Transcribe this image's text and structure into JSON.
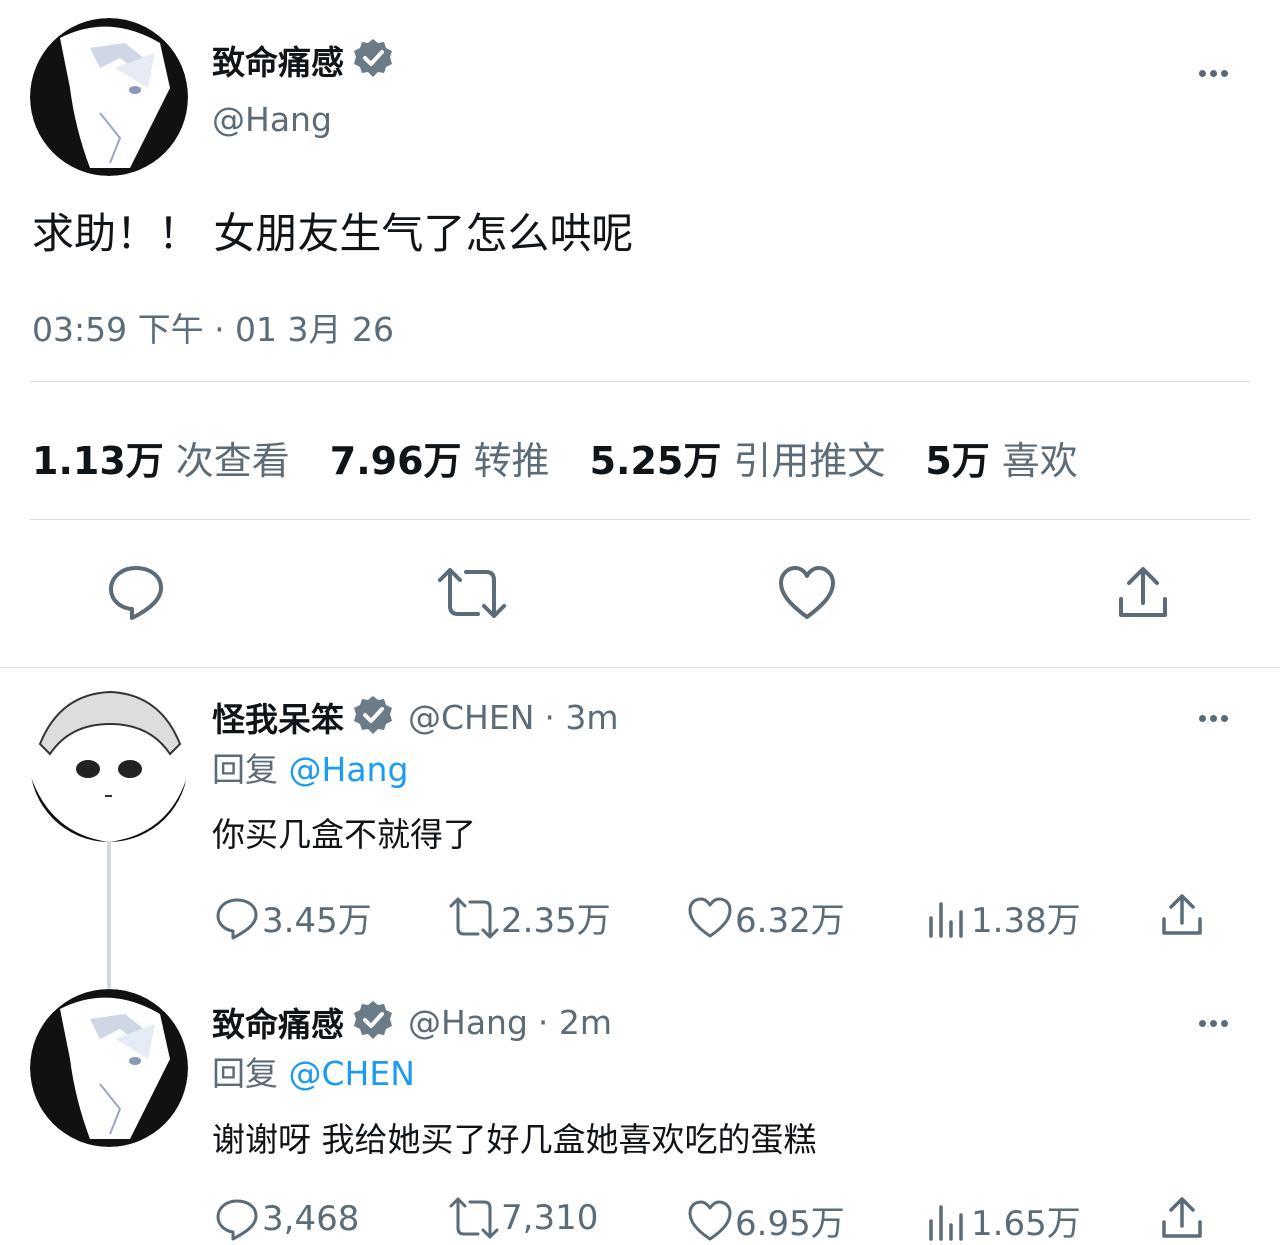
{
  "main_post": {
    "display_name": "致命痛感",
    "handle": "@Hang",
    "text": "求助！！ 女朋友生气了怎么哄呢",
    "timestamp": "03:59 下午 · 01 3月 26",
    "stats": [
      {
        "value": "1.13万",
        "label": "次查看"
      },
      {
        "value": "7.96万",
        "label": "转推"
      },
      {
        "value": "5.25万",
        "label": "引用推文"
      },
      {
        "value": "5万",
        "label": "喜欢"
      }
    ]
  },
  "replies": [
    {
      "display_name": "怪我呆笨",
      "handle": "@CHEN",
      "time": "· 3m",
      "reply_prefix": "回复 ",
      "reply_to": "@Hang",
      "text": "你买几盒不就得了",
      "metrics": {
        "replies": "3.45万",
        "retweets": "2.35万",
        "likes": "6.32万",
        "views": "1.38万"
      }
    },
    {
      "display_name": "致命痛感",
      "handle": "@Hang",
      "time": "· 2m",
      "reply_prefix": "回复 ",
      "reply_to": "@CHEN",
      "text": "谢谢呀 我给她买了好几盒她喜欢吃的蛋糕",
      "metrics": {
        "replies": "3,468",
        "retweets": "7,310",
        "likes": "6.95万",
        "views": "1.65万"
      }
    }
  ],
  "icons": {
    "verified": "verified-badge-icon",
    "reply": "reply-icon",
    "retweet": "retweet-icon",
    "like": "heart-icon",
    "share": "share-icon",
    "views": "views-icon",
    "more": "more-icon"
  },
  "colors": {
    "text": "#0f1419",
    "secondary": "#5b6b78",
    "link": "#1d9bf0",
    "divider": "#d9dee2"
  }
}
